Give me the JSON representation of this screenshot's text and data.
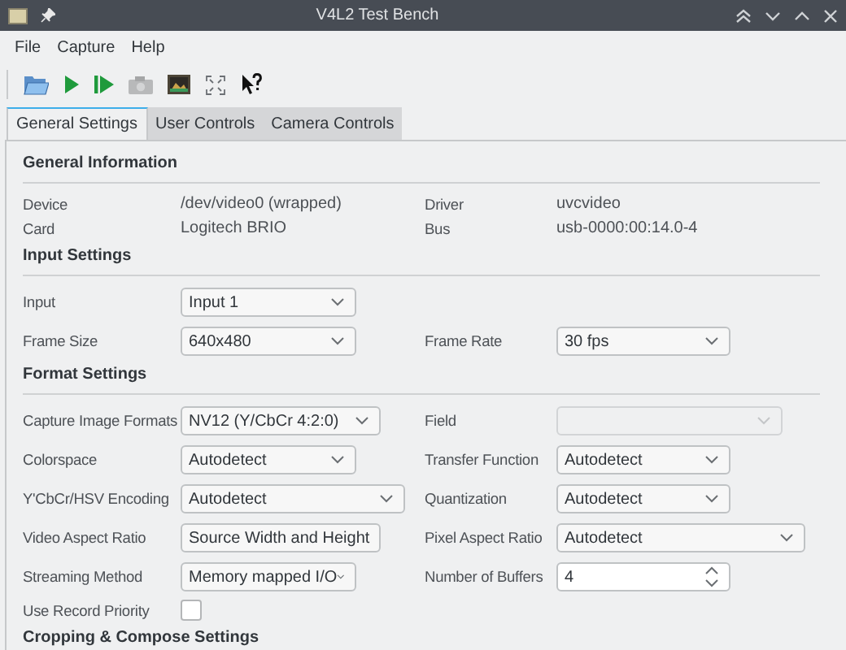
{
  "window": {
    "title": "V4L2 Test Bench"
  },
  "menu": [
    "File",
    "Capture",
    "Help"
  ],
  "tabs": [
    {
      "label": "General Settings",
      "selected": true
    },
    {
      "label": "User Controls",
      "selected": false
    },
    {
      "label": "Camera Controls",
      "selected": false
    }
  ],
  "sections": [
    {
      "title": "General Information",
      "rows": [
        {
          "left": {
            "kind": "info",
            "label": "Device",
            "value": "/dev/video0 (wrapped)"
          },
          "right": {
            "kind": "info",
            "label": "Driver",
            "value": "uvcvideo"
          }
        },
        {
          "left": {
            "kind": "info",
            "label": "Card",
            "value": "Logitech BRIO"
          },
          "right": {
            "kind": "info",
            "label": "Bus",
            "value": "usb-0000:00:14.0-4"
          }
        }
      ]
    },
    {
      "title": "Input Settings",
      "rows": [
        {
          "left": {
            "kind": "combo",
            "label": "Input",
            "value": "Input 1",
            "disabled": false
          }
        },
        {
          "left": {
            "kind": "combo",
            "label": "Frame Size",
            "value": "640x480",
            "disabled": false
          },
          "right": {
            "kind": "combo",
            "label": "Frame Rate",
            "value": "30 fps",
            "disabled": false
          }
        }
      ]
    },
    {
      "title": "Format Settings",
      "rows": [
        {
          "left": {
            "kind": "combo",
            "label": "Capture Image Formats",
            "value": "NV12 (Y/CbCr 4:2:0)",
            "disabled": false
          },
          "right": {
            "kind": "combo",
            "label": "Field",
            "disabled": true
          }
        },
        {
          "left": {
            "kind": "combo",
            "label": "Colorspace",
            "value": "Autodetect",
            "disabled": false
          },
          "right": {
            "kind": "combo",
            "label": "Transfer Function",
            "value": "Autodetect",
            "disabled": false
          }
        },
        {
          "left": {
            "kind": "combo",
            "label": "Y'CbCr/HSV Encoding",
            "value": "Autodetect",
            "disabled": false
          },
          "right": {
            "kind": "combo",
            "label": "Quantization",
            "value": "Autodetect",
            "disabled": false
          }
        },
        {
          "left": {
            "kind": "combo",
            "label": "Video Aspect Ratio",
            "value": "Source Width and Height",
            "disabled": false
          },
          "right": {
            "kind": "combo",
            "label": "Pixel Aspect Ratio",
            "value": "Autodetect",
            "disabled": false
          }
        },
        {
          "left": {
            "kind": "combo",
            "label": "Streaming Method",
            "value": "Memory mapped I/O",
            "disabled": false
          },
          "right": {
            "kind": "spin",
            "label": "Number of Buffers",
            "value": "4"
          }
        },
        {
          "left": {
            "kind": "checkbox",
            "label": "Use Record Priority",
            "checked": false
          }
        }
      ]
    },
    {
      "title": "Cropping & Compose Settings"
    }
  ]
}
